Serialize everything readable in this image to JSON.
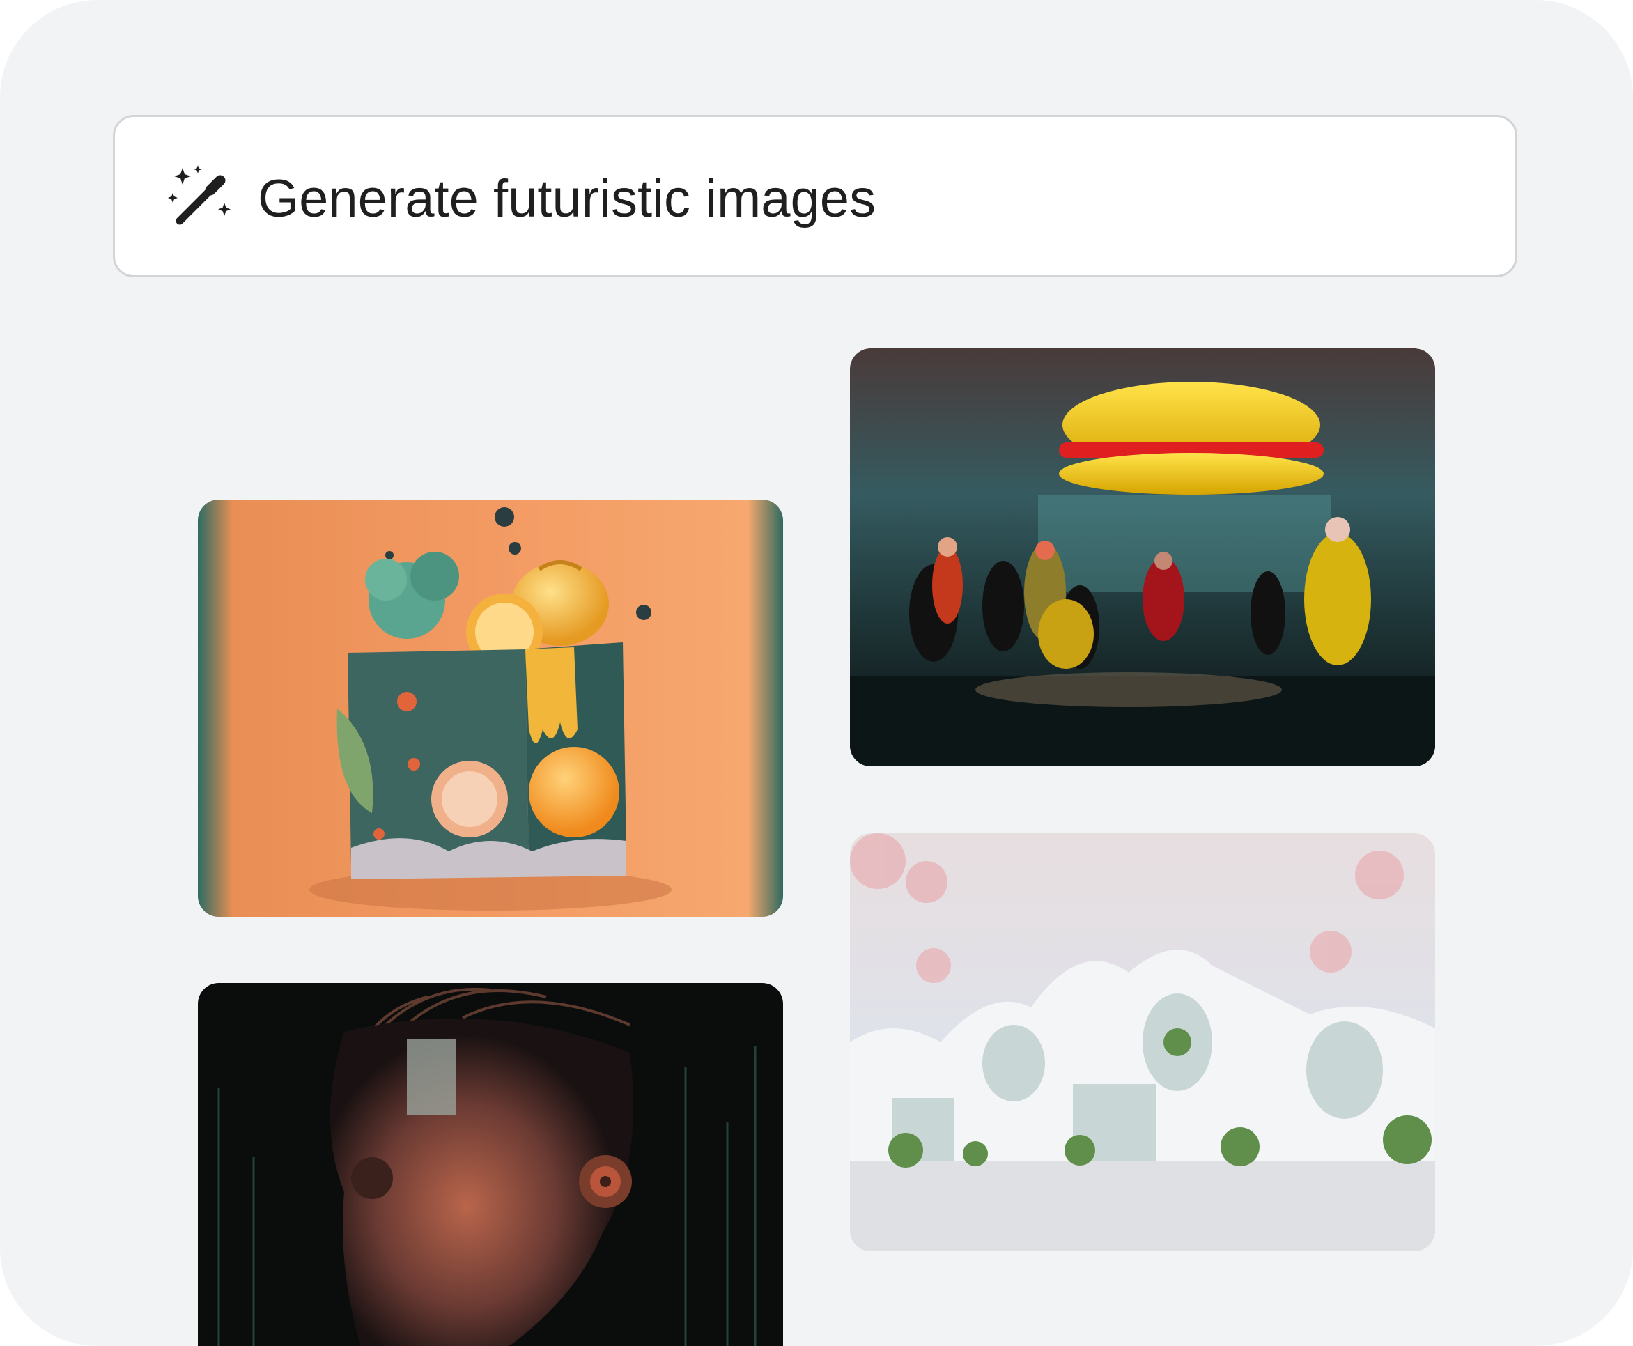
{
  "prompt": {
    "icon": "magic-wand-icon",
    "text": "Generate futuristic images"
  },
  "gallery": {
    "images": [
      {
        "name": "fruit-cube-image"
      },
      {
        "name": "burger-crowd-image"
      },
      {
        "name": "organic-house-image"
      },
      {
        "name": "cyber-head-image"
      }
    ]
  },
  "colors": {
    "panel_bg": "#f2f3f5",
    "prompt_border": "#d3d4d7",
    "text": "#1f1f1f"
  }
}
